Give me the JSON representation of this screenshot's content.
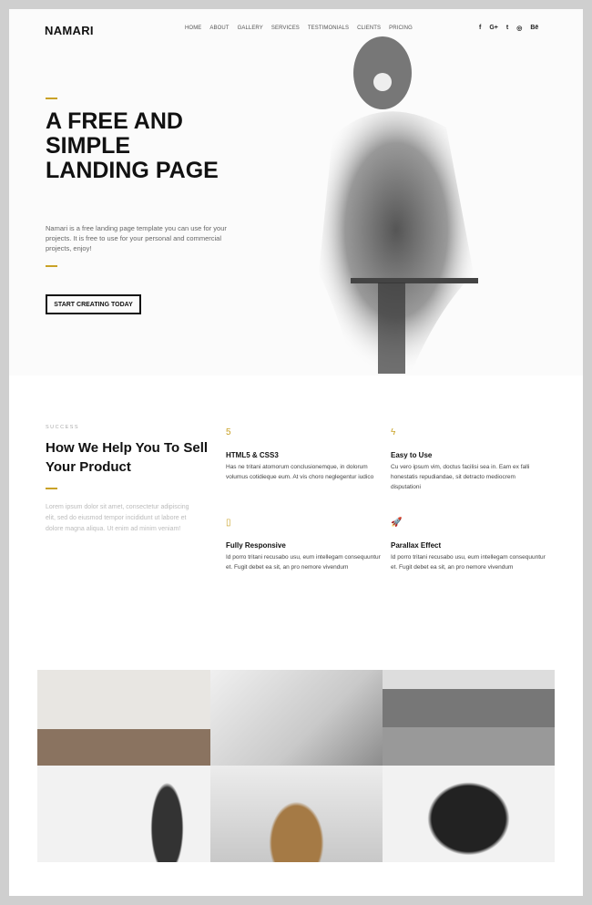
{
  "header": {
    "logo": "NAMARI",
    "nav": [
      "HOME",
      "ABOUT",
      "GALLERY",
      "SERVICES",
      "TESTIMONIALS",
      "CLIENTS",
      "PRICING"
    ],
    "social": [
      {
        "icon": "facebook-icon",
        "glyph": "f"
      },
      {
        "icon": "google-plus-icon",
        "glyph": "G+"
      },
      {
        "icon": "twitter-icon",
        "glyph": "t"
      },
      {
        "icon": "instagram-icon",
        "glyph": "◎"
      },
      {
        "icon": "behance-icon",
        "glyph": "Bē"
      }
    ]
  },
  "hero": {
    "title": "A FREE AND SIMPLE LANDING PAGE",
    "text": "Namari is a free landing page template you can use for your projects. It is free to use for your personal and commercial projects, enjoy!",
    "cta": "START CREATING TODAY"
  },
  "services": {
    "eyebrow": "SUCCESS",
    "title": "How We Help You To Sell Your Product",
    "text": "Lorem ipsum dolor sit amet, consectetur adipiscing elit, sed do eiusmod tempor incididunt ut labore et dolore magna aliqua. Ut enim ad minim veniam!",
    "features": [
      {
        "icon": "html5-icon",
        "glyph": "5",
        "title": "HTML5 & CSS3",
        "text": "Has ne tritani atomorum conclusionemque, in dolorum volumus cotidieque eum. At vis choro neglegentur iudico"
      },
      {
        "icon": "bolt-icon",
        "glyph": "ϟ",
        "title": "Easy to Use",
        "text": "Cu vero ipsum vim, doctus facilisi sea in. Eam ex falli honestatis repudiandae, sit detracto mediocrem disputationi"
      },
      {
        "icon": "tablet-icon",
        "glyph": "▯",
        "title": "Fully Responsive",
        "text": "Id porro tritani recusabo usu, eum intellegam consequuntur et. Fugit debet ea sit, an pro nemore vivendum"
      },
      {
        "icon": "rocket-icon",
        "glyph": "🚀",
        "title": "Parallax Effect",
        "text": "Id porro tritani recusabo usu, eum intellegam consequuntur et. Fugit debet ea sit, an pro nemore vivendum"
      }
    ]
  },
  "accent": "#c9a227"
}
